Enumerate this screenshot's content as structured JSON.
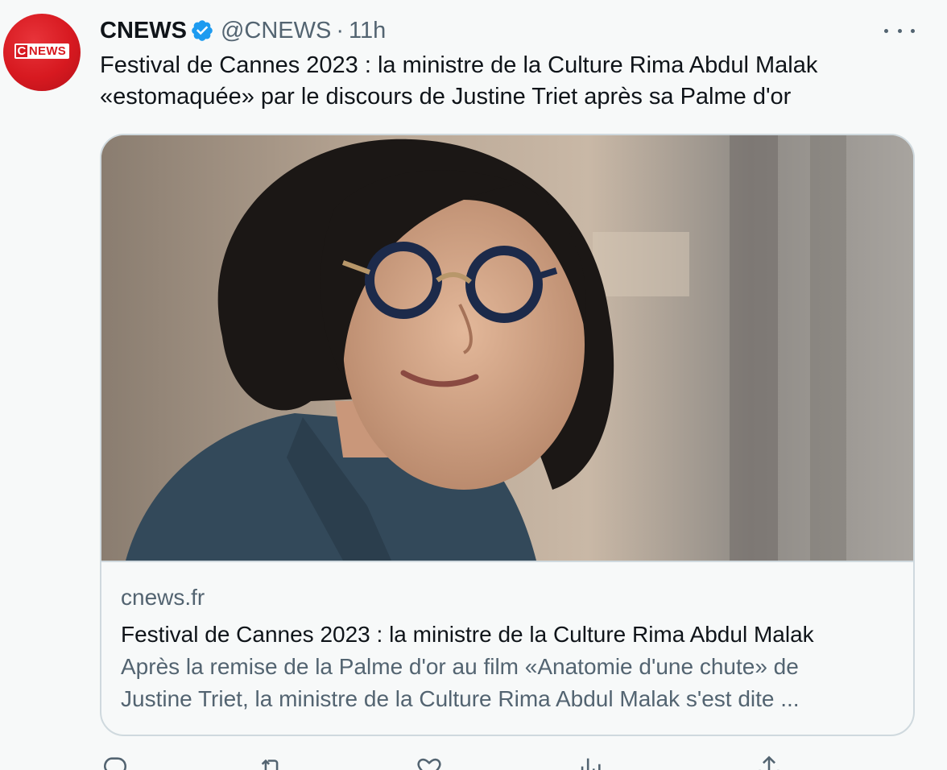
{
  "tweet": {
    "display_name": "CNEWS",
    "handle": "@CNEWS",
    "separator": "·",
    "timestamp": "11h",
    "avatar_logo_letter": "C",
    "avatar_logo_word": "NEWS",
    "text_line1": "Festival de Cannes 2023 : la ministre de la Culture Rima Abdul Malak",
    "text_line2": "«estomaquée» par le discours de Justine Triet après sa Palme d'or"
  },
  "card": {
    "domain": "cnews.fr",
    "title": "Festival de Cannes 2023 : la ministre de la Culture Rima Abdul Malak",
    "description_line1": "Après la remise de la Palme d'or au film «Anatomie d'une chute» de",
    "description_line2": "Justine Triet, la ministre de la Culture Rima Abdul Malak s'est dite ..."
  },
  "actions": {
    "reply_count": "",
    "retweet_count": "",
    "like_count": "",
    "views_count": ""
  },
  "colors": {
    "brand_red": "#d71920",
    "verified_blue": "#1d9bf0",
    "secondary_text": "#536471",
    "border": "#cfd9de",
    "background": "#f7f9f9"
  },
  "icons": [
    "verified-badge-icon",
    "more-options-icon",
    "reply-icon",
    "retweet-icon",
    "like-icon",
    "views-icon",
    "share-icon"
  ]
}
